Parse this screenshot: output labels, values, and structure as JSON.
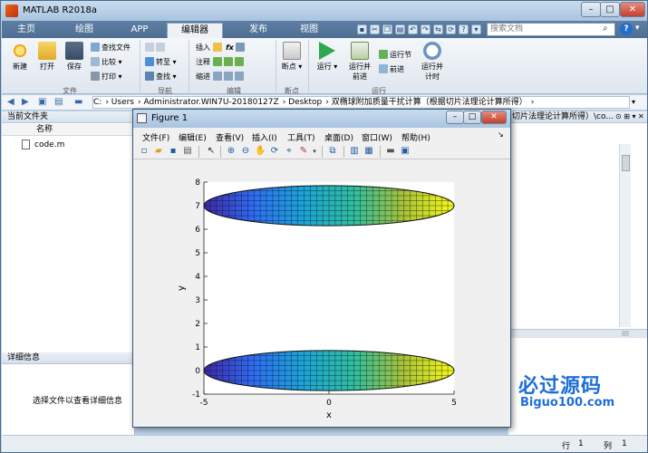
{
  "app": {
    "title": "MATLAB R2018a",
    "tabs": [
      "主页",
      "绘图",
      "APP",
      "编辑器",
      "发布",
      "视图"
    ],
    "active_tab": "编辑器",
    "search_placeholder": "搜索文档"
  },
  "ribbon": {
    "file_group": {
      "label": "文件",
      "new": "新建",
      "open": "打开",
      "save": "保存",
      "find_files": "查找文件",
      "compare": "比较",
      "print": "打印"
    },
    "nav_group": {
      "label": "导航",
      "goto": "转至",
      "find": "查找"
    },
    "edit_group": {
      "label": "编辑",
      "insert": "插入",
      "comment": "注释",
      "indent": "缩进",
      "fx": "fx"
    },
    "breakpoint_group": {
      "label": "断点",
      "breakpoints": "断点"
    },
    "run_group": {
      "label": "运行",
      "run": "运行",
      "run_and_advance_1": "运行并",
      "run_and_advance_2": "前进",
      "run_section": "运行节",
      "advance": "前进",
      "run_and_time_1": "运行并",
      "run_and_time_2": "计时"
    }
  },
  "address": {
    "segments": [
      "C:",
      "Users",
      "Administrator.WIN7U-20180127Z",
      "Desktop",
      "双椭球附加质量干扰计算（根据切片法理论计算所得）"
    ]
  },
  "current_folder": {
    "header": "当前文件夹",
    "column_name": "名称",
    "files": [
      "code.m"
    ]
  },
  "details": {
    "header": "详细信息",
    "message": "选择文件以查看详细信息"
  },
  "right_panel": {
    "header": "切片法理论计算所得）\\co..."
  },
  "status": {
    "row_label": "行",
    "row_value": "1",
    "col_label": "列",
    "col_value": "1"
  },
  "watermark": {
    "title": "必过源码",
    "url": "Biguo100.com"
  },
  "figure": {
    "title": "Figure 1",
    "menu": [
      "文件(F)",
      "编辑(E)",
      "查看(V)",
      "插入(I)",
      "工具(T)",
      "桌面(D)",
      "窗口(W)",
      "帮助(H)"
    ]
  },
  "chart_data": {
    "type": "surface",
    "title": "",
    "xlabel": "x",
    "ylabel": "y",
    "xlim": [
      -5,
      5
    ],
    "ylim": [
      -1,
      8
    ],
    "xticks": [
      -5,
      0,
      5
    ],
    "yticks": [
      -1,
      0,
      1,
      2,
      3,
      4,
      5,
      6,
      7,
      8
    ],
    "colormap": "parula",
    "series": [
      {
        "center_x": 0,
        "center_y": 7,
        "semi_x": 5,
        "semi_y": 0.85
      },
      {
        "center_x": 0,
        "center_y": 0,
        "semi_x": 5,
        "semi_y": 0.85
      }
    ],
    "grid": false
  }
}
